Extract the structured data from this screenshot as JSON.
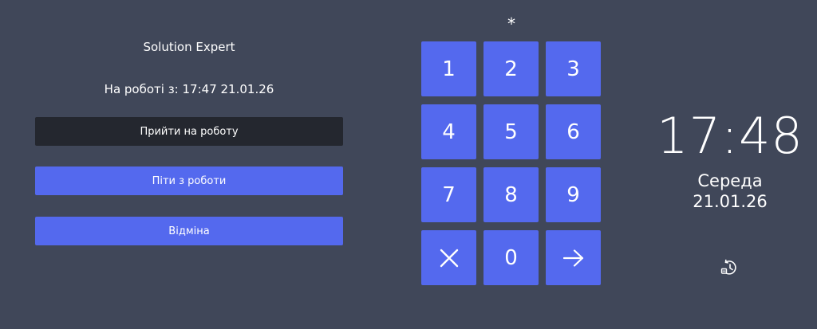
{
  "user": {
    "name": "Solution Expert",
    "status": "На роботі з: 17:47 21.01.26"
  },
  "actions": {
    "check_in": "Прийти на роботу",
    "check_out": "Піти з роботи",
    "cancel": "Відміна"
  },
  "pin": {
    "display": "*"
  },
  "keypad": {
    "keys": [
      "1",
      "2",
      "3",
      "4",
      "5",
      "6",
      "7",
      "8",
      "9",
      "0"
    ],
    "clear_icon": "close-icon",
    "enter_icon": "arrow-right-icon"
  },
  "clock": {
    "time": "17:48",
    "weekday": "Середа",
    "date": "21.01.26"
  },
  "history": {
    "icon": "history-icon"
  },
  "colors": {
    "background": "#404759",
    "accent": "#5469ee",
    "dark_button": "#24272f",
    "text": "#ffffff"
  }
}
